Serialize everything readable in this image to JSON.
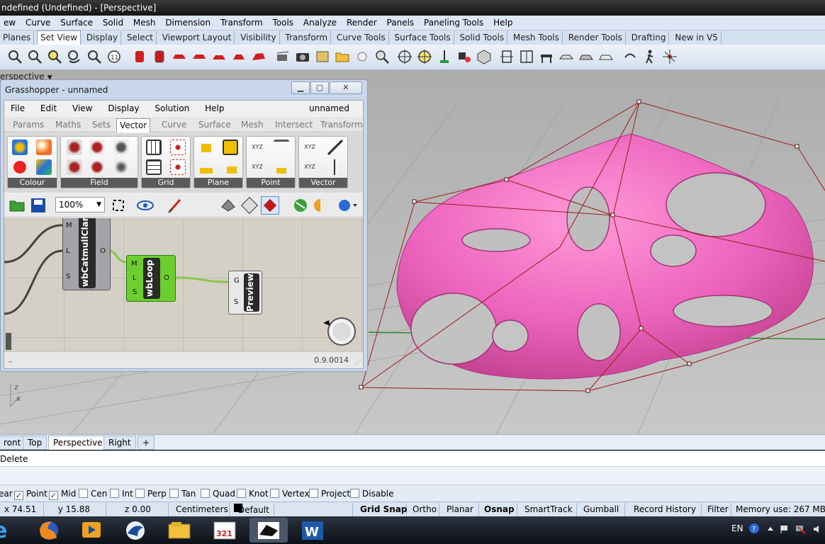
{
  "window": {
    "title": "ndefined (Undefined) - [Perspective]"
  },
  "menu": [
    "ew",
    "Curve",
    "Surface",
    "Solid",
    "Mesh",
    "Dimension",
    "Transform",
    "Tools",
    "Analyze",
    "Render",
    "Panels",
    "Paneling Tools",
    "Help"
  ],
  "toolbar_tabs": [
    "Planes",
    "Set View",
    "Display",
    "Select",
    "Viewport Layout",
    "Visibility",
    "Transform",
    "Curve Tools",
    "Surface Tools",
    "Solid Tools",
    "Mesh Tools",
    "Render Tools",
    "Drafting",
    "New in V5"
  ],
  "active_toolbar_tab": "Set View",
  "viewport": {
    "label": "erspective",
    "axis_z": "z",
    "axis_x": "x"
  },
  "view_tabs": [
    "ront",
    "Top",
    "Perspective",
    "Right"
  ],
  "active_view_tab": "Perspective",
  "command_line": "Delete",
  "osnap": [
    {
      "label": "ear",
      "checked": null
    },
    {
      "label": "Point",
      "checked": true
    },
    {
      "label": "Mid",
      "checked": true
    },
    {
      "label": "Cen",
      "checked": false
    },
    {
      "label": "Int",
      "checked": false
    },
    {
      "label": "Perp",
      "checked": false
    },
    {
      "label": "Tan",
      "checked": false
    },
    {
      "label": "Quad",
      "checked": false
    },
    {
      "label": "Knot",
      "checked": false
    },
    {
      "label": "Vertex",
      "checked": false
    },
    {
      "label": "Project",
      "checked": false
    },
    {
      "label": "Disable",
      "checked": false
    }
  ],
  "status": {
    "x": "x 74.51",
    "y": "y 15.88",
    "z": "z 0.00",
    "units": "Centimeters",
    "layer": "Default",
    "toggles": [
      "Grid Snap",
      "Ortho",
      "Planar",
      "Osnap",
      "SmartTrack",
      "Gumball",
      "Record History",
      "Filter"
    ],
    "bold_toggles": [
      "Grid Snap",
      "Osnap"
    ],
    "memory": "Memory use: 267 MB"
  },
  "taskbar": {
    "language": "EN"
  },
  "grasshopper": {
    "title": "Grasshopper - unnamed",
    "menu": [
      "File",
      "Edit",
      "View",
      "Display",
      "Solution",
      "Help"
    ],
    "file_name": "unnamed",
    "tabs": [
      "Params",
      "Maths",
      "Sets",
      "Vector",
      "Curve",
      "Surface",
      "Mesh",
      "Intersect",
      "Transform"
    ],
    "active_tab": "Vector",
    "groups": [
      "Colour",
      "Field",
      "Grid",
      "Plane",
      "Point",
      "Vector"
    ],
    "zoom": "100%",
    "version": "0.9.0014",
    "components": [
      {
        "name": "wbCatmullClar",
        "inputs": [
          "M",
          "L",
          "S"
        ],
        "outputs": [
          "O"
        ]
      },
      {
        "name": "wbLoop",
        "inputs": [
          "M",
          "L",
          "S"
        ],
        "outputs": [
          "O"
        ]
      },
      {
        "name": "Preview",
        "inputs": [
          "G",
          "S"
        ],
        "outputs": []
      }
    ]
  },
  "colors": {
    "accent_pink": "#ef6fc2",
    "control_polygon": "#9e1b1b",
    "gh_green": "#6ccf2f"
  }
}
